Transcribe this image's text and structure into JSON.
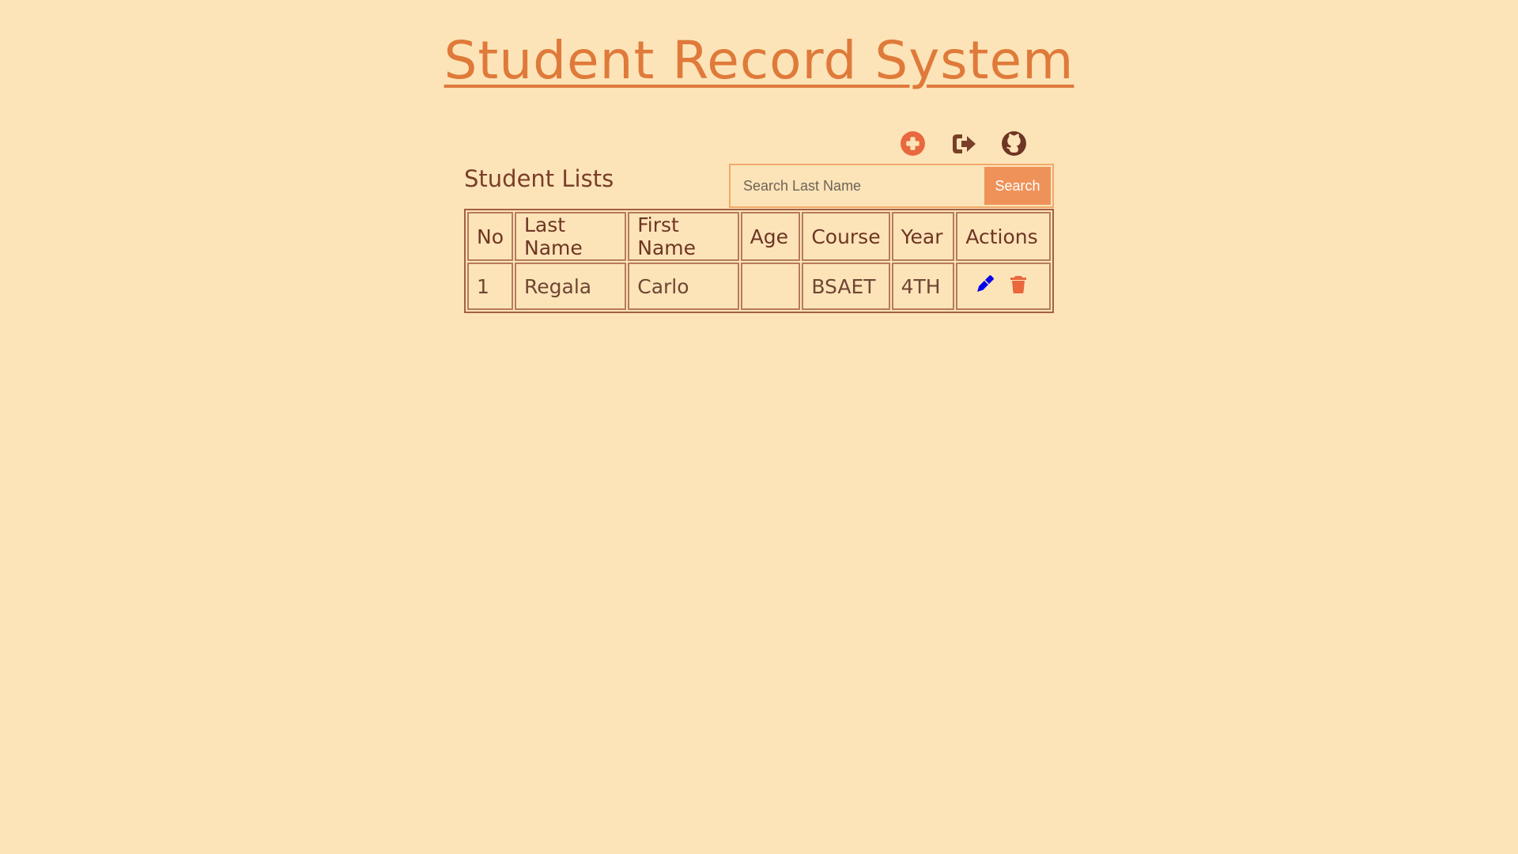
{
  "header": {
    "title": "Student Record System"
  },
  "toolbar": {
    "icons": [
      "add-circle-icon",
      "sign-out-icon",
      "github-icon"
    ],
    "colors": {
      "add": "#e9683d",
      "signout": "#7a3e2a",
      "github": "#6e3524"
    }
  },
  "list": {
    "title": "Student Lists"
  },
  "search": {
    "placeholder": "Search Last Name",
    "value": "",
    "button_label": "Search"
  },
  "table": {
    "columns": [
      "No",
      "Last Name",
      "First Name",
      "Age",
      "Course",
      "Year",
      "Actions"
    ],
    "rows": [
      {
        "no": "1",
        "last_name": "Regala",
        "first_name": "Carlo",
        "age": "",
        "course": "BSAET",
        "year": "4TH",
        "actions": [
          "edit-pen-icon",
          "delete-trash-icon"
        ]
      }
    ]
  },
  "colors": {
    "background": "#fce4b8",
    "title": "#df7a3a",
    "accent": "#ef9259",
    "text": "#7a3e2a",
    "edit": "#0000ee",
    "delete": "#e9683d"
  }
}
